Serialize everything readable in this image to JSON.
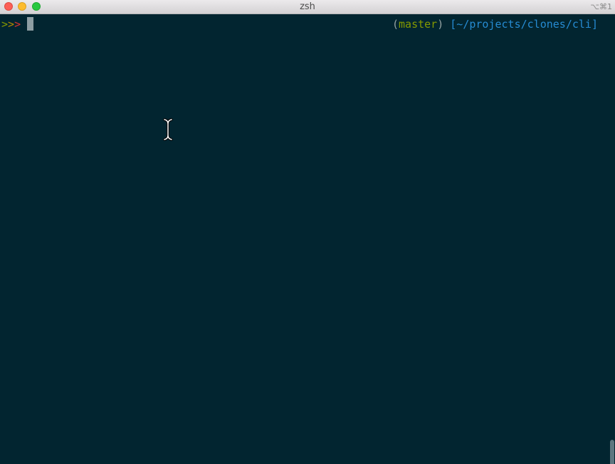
{
  "window": {
    "title": "zsh",
    "shortcut": "⌥⌘1"
  },
  "prompt": {
    "chevron1": ">",
    "chevron2": ">",
    "chevron3": ">",
    "open_paren": "(",
    "branch": "master",
    "close_paren": ")",
    "path": "[~/projects/clones/cli]"
  },
  "colors": {
    "background": "#022530",
    "branch": "#859900",
    "path": "#268bd2",
    "chevron_green": "#859900",
    "chevron_yellow": "#b58900",
    "chevron_red": "#dc322f"
  },
  "icons": {
    "mouse_cursor": "ibeam-cursor-icon"
  }
}
